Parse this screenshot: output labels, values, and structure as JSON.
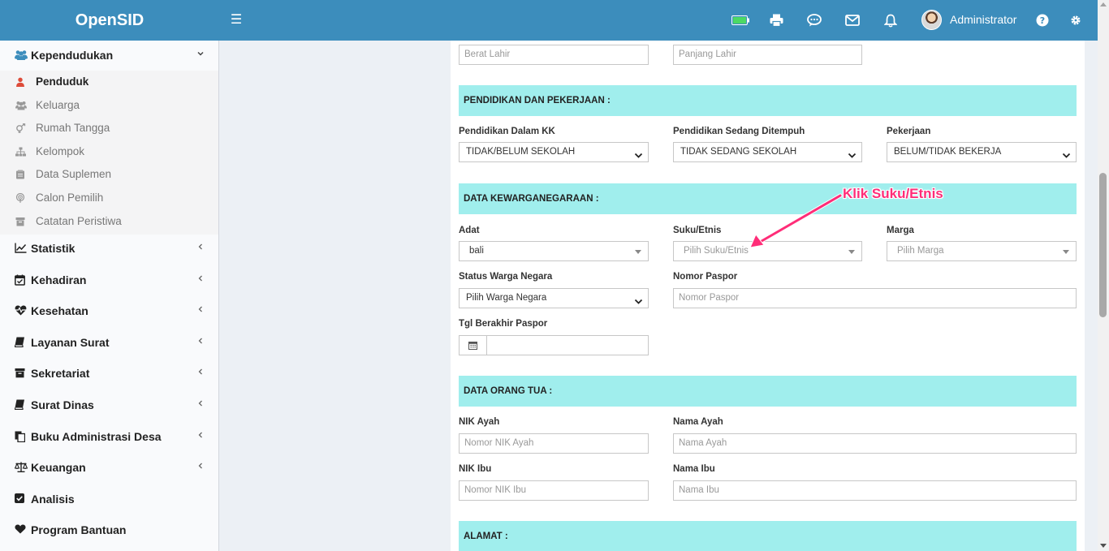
{
  "header": {
    "logo": "OpenSID",
    "user_name": "Administrator",
    "colors": {
      "bar": "#3c8dbc",
      "battery": "#4cd964"
    },
    "icons": [
      "menu-icon",
      "battery-icon",
      "print-icon",
      "chat-icon",
      "mail-icon",
      "bell-icon",
      "help-icon",
      "gear-icon"
    ]
  },
  "sidebar": {
    "menus": [
      {
        "label": "Kependudukan",
        "icon": "users-icon",
        "open": true
      },
      {
        "label": "Statistik",
        "icon": "chart-icon"
      },
      {
        "label": "Kehadiran",
        "icon": "calendar-check-icon"
      },
      {
        "label": "Kesehatan",
        "icon": "heartbeat-icon"
      },
      {
        "label": "Layanan Surat",
        "icon": "book-icon"
      },
      {
        "label": "Sekretariat",
        "icon": "archive-icon"
      },
      {
        "label": "Surat Dinas",
        "icon": "book-icon"
      },
      {
        "label": "Buku Administrasi Desa",
        "icon": "copy-icon"
      },
      {
        "label": "Keuangan",
        "icon": "balance-scale-icon"
      },
      {
        "label": "Analisis",
        "icon": "check-square-icon"
      },
      {
        "label": "Program Bantuan",
        "icon": "heart-icon"
      }
    ],
    "submenu": [
      {
        "label": "Penduduk",
        "icon": "user-icon",
        "active": true
      },
      {
        "label": "Keluarga",
        "icon": "users-icon"
      },
      {
        "label": "Rumah Tangga",
        "icon": "venus-mars-icon"
      },
      {
        "label": "Kelompok",
        "icon": "sitemap-icon"
      },
      {
        "label": "Data Suplemen",
        "icon": "clipboard-icon"
      },
      {
        "label": "Calon Pemilih",
        "icon": "podcast-icon"
      },
      {
        "label": "Catatan Peristiwa",
        "icon": "archive-icon"
      }
    ]
  },
  "form": {
    "berat_lahir_placeholder": "Berat Lahir",
    "panjang_lahir_placeholder": "Panjang Lahir",
    "sec_pendidikan": "PENDIDIKAN DAN PEKERJAAN :",
    "pendidikan_kk_label": "Pendidikan Dalam KK",
    "pendidikan_kk_value": "TIDAK/BELUM SEKOLAH",
    "pendidikan_tempuh_label": "Pendidikan Sedang Ditempuh",
    "pendidikan_tempuh_value": "TIDAK SEDANG SEKOLAH",
    "pekerjaan_label": "Pekerjaan",
    "pekerjaan_value": "BELUM/TIDAK BEKERJA",
    "sec_kewarganegaraan": "DATA KEWARGANEGARAAN :",
    "adat_label": "Adat",
    "adat_value": "bali",
    "suku_label": "Suku/Etnis",
    "suku_placeholder": "Pilih Suku/Etnis",
    "marga_label": "Marga",
    "marga_placeholder": "Pilih Marga",
    "status_wn_label": "Status Warga Negara",
    "status_wn_value": "Pilih Warga Negara",
    "paspor_label": "Nomor Paspor",
    "paspor_placeholder": "Nomor Paspor",
    "tgl_paspor_label": "Tgl Berakhir Paspor",
    "sec_orang_tua": "DATA ORANG TUA :",
    "nik_ayah_label": "NIK Ayah",
    "nik_ayah_placeholder": "Nomor NIK Ayah",
    "nama_ayah_label": "Nama Ayah",
    "nama_ayah_placeholder": "Nama Ayah",
    "nik_ibu_label": "NIK Ibu",
    "nik_ibu_placeholder": "Nomor NIK Ibu",
    "nama_ibu_label": "Nama Ibu",
    "nama_ibu_placeholder": "Nama Ibu",
    "sec_alamat": "ALAMAT :",
    "section_color": "#a0eeed"
  },
  "annotation": {
    "text": "Klik Suku/Etnis",
    "color": "#ff2d78"
  }
}
